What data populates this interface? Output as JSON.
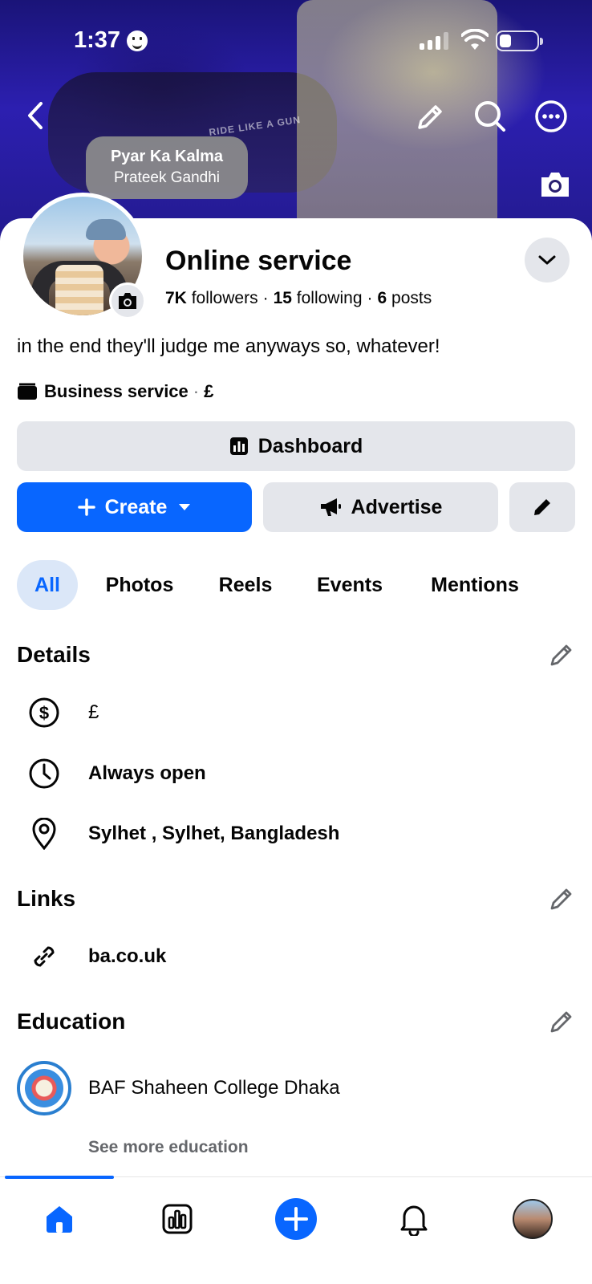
{
  "status_bar": {
    "time": "1:37"
  },
  "cover": {
    "music": {
      "song": "Pyar Ka Kalma",
      "artist": "Prateek Gandhi"
    },
    "graffiti_text": "RIDE LIKE A GUN"
  },
  "profile": {
    "name": "Online service",
    "followers_count": "7K",
    "followers_label": "followers",
    "following_count": "15",
    "following_label": "following",
    "posts_count": "6",
    "posts_label": "posts",
    "bio": "in the end they'll judge me anyways so, whatever!",
    "category": "Business service",
    "price_range": "£"
  },
  "actions": {
    "dashboard_label": "Dashboard",
    "create_label": "Create",
    "advertise_label": "Advertise"
  },
  "tabs": [
    {
      "label": "All",
      "active": true
    },
    {
      "label": "Photos"
    },
    {
      "label": "Reels"
    },
    {
      "label": "Events"
    },
    {
      "label": "Mentions"
    }
  ],
  "details": {
    "title": "Details",
    "price": "£",
    "hours": "Always open",
    "location": "Sylhet , Sylhet, Bangladesh"
  },
  "links": {
    "title": "Links",
    "website": "ba.co.uk"
  },
  "education": {
    "title": "Education",
    "school": "BAF Shaheen College Dhaka",
    "see_more": "See more education"
  },
  "colors": {
    "accent": "#0866ff",
    "button_grey": "#e4e6eb",
    "secondary_text": "#65676b"
  }
}
